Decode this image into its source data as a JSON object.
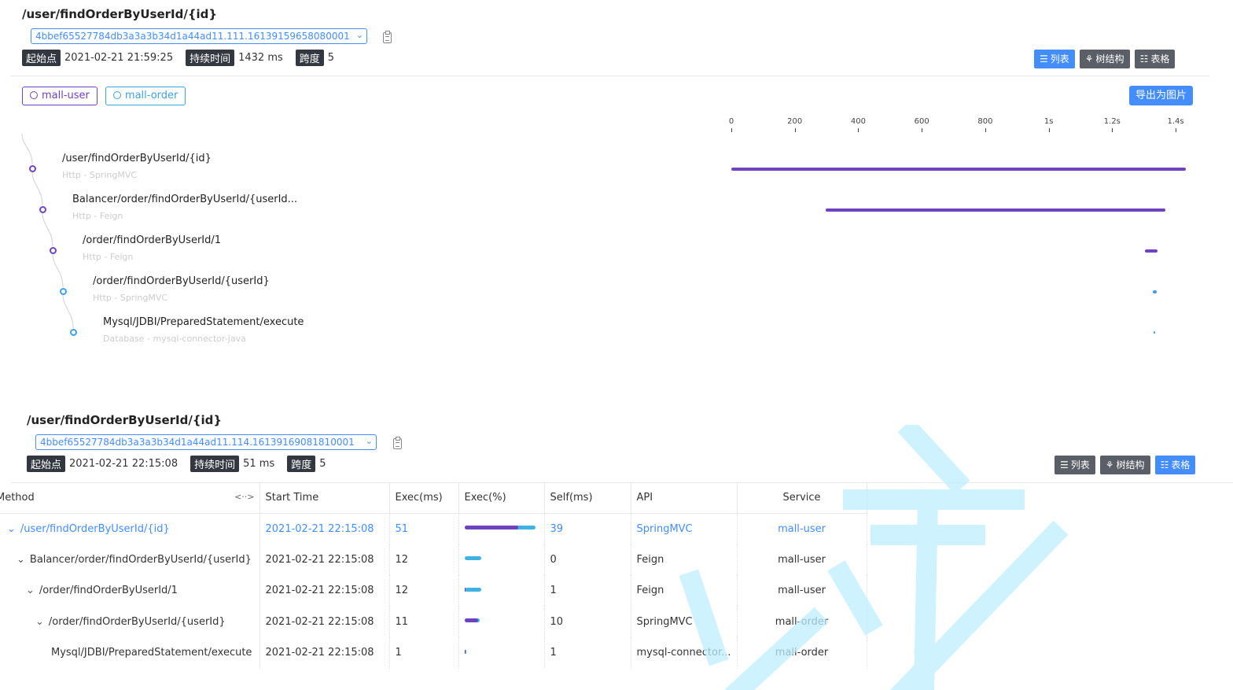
{
  "trace1": {
    "title": "/user/findOrderByUserId/{id}",
    "trace_id": "4bbef65527784db3a3a3b34d1a44ad11.111.16139159658080001",
    "start_label": "起始点",
    "start_value": "2021-02-21 21:59:25",
    "duration_label": "持续时间",
    "duration_value": "1432 ms",
    "span_label": "跨度",
    "span_value": "5",
    "views": [
      "列表",
      "树结构",
      "表格"
    ],
    "active_view": 0,
    "services": [
      {
        "name": "mall-user",
        "color": "#6f42c1"
      },
      {
        "name": "mall-order",
        "color": "#3fa0e3"
      }
    ],
    "export_label": "导出为图片",
    "axis_ticks": [
      "0",
      "200",
      "400",
      "600",
      "800",
      "1s",
      "1.2s",
      "1.4s"
    ],
    "axis_max": 1432,
    "spans": [
      {
        "name": "/user/findOrderByUserId/{id}",
        "sub": "Http - SpringMVC",
        "start": 0,
        "duration": 1432,
        "service": 0
      },
      {
        "name": "Balancer/order/findOrderByUserId/{userId...",
        "sub": "Http - Feign",
        "start": 298,
        "duration": 1069,
        "service": 0
      },
      {
        "name": "/order/findOrderByUserId/1",
        "sub": "Http - Feign",
        "start": 1302,
        "duration": 40,
        "service": 0
      },
      {
        "name": "/order/findOrderByUserId/{userId}",
        "sub": "Http - SpringMVC",
        "start": 1328,
        "duration": 12,
        "service": 1
      },
      {
        "name": "Mysql/JDBI/PreparedStatement/execute",
        "sub": "Database - mysql-connector-java",
        "start": 1331,
        "duration": 4,
        "service": 1
      }
    ]
  },
  "trace2": {
    "title": "/user/findOrderByUserId/{id}",
    "trace_id": "4bbef65527784db3a3a3b34d1a44ad11.114.16139169081810001",
    "start_label": "起始点",
    "start_value": "2021-02-21 22:15:08",
    "duration_label": "持续时间",
    "duration_value": "51 ms",
    "span_label": "跨度",
    "span_value": "5",
    "views": [
      "列表",
      "树结构",
      "表格"
    ],
    "active_view": 2,
    "table": {
      "columns": [
        "Method",
        "Start Time",
        "Exec(ms)",
        "Exec(%)",
        "Self(ms)",
        "API",
        "Service"
      ],
      "resize_icon": "<··>",
      "rows": [
        {
          "method": "/user/findOrderByUserId/{id}",
          "start": "2021-02-21 22:15:08",
          "exec": "51",
          "exec_pct": 1.0,
          "self": "39",
          "self_pct": 0.76,
          "api": "SpringMVC",
          "service": "mall-user",
          "level": 0,
          "expandable": true,
          "highlight": true
        },
        {
          "method": "Balancer/order/findOrderByUserId/{userId}",
          "start": "2021-02-21 22:15:08",
          "exec": "12",
          "exec_pct": 0.235,
          "self": "0",
          "self_pct": 0.0,
          "api": "Feign",
          "service": "mall-user",
          "level": 1,
          "expandable": true,
          "highlight": false
        },
        {
          "method": "/order/findOrderByUserId/1",
          "start": "2021-02-21 22:15:08",
          "exec": "12",
          "exec_pct": 0.235,
          "self": "1",
          "self_pct": 0.02,
          "api": "Feign",
          "service": "mall-user",
          "level": 2,
          "expandable": true,
          "highlight": false
        },
        {
          "method": "/order/findOrderByUserId/{userId}",
          "start": "2021-02-21 22:15:08",
          "exec": "11",
          "exec_pct": 0.215,
          "self": "10",
          "self_pct": 0.196,
          "api": "SpringMVC",
          "service": "mall-order",
          "level": 3,
          "expandable": true,
          "highlight": false
        },
        {
          "method": "Mysql/JDBI/PreparedStatement/execute",
          "start": "2021-02-21 22:15:08",
          "exec": "1",
          "exec_pct": 0.02,
          "self": "1",
          "self_pct": 0.02,
          "api": "mysql-connector...",
          "service": "mall-order",
          "level": 4,
          "expandable": false,
          "highlight": false
        }
      ]
    }
  },
  "colors": {
    "accent": "#448dfe",
    "purple": "#6f42c1",
    "teal": "#3fb1e3",
    "dark_tag": "#333840"
  }
}
